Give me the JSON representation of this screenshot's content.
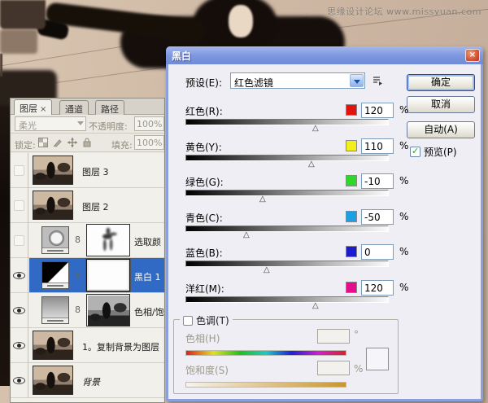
{
  "watermark": "思缘设计论坛 www.missyuan.com",
  "layers_panel": {
    "tabs": [
      {
        "label": "图层"
      },
      {
        "label": "通道"
      },
      {
        "label": "路径"
      }
    ],
    "tab_close": "×",
    "blend_mode": "柔光",
    "opacity_label": "不透明度:",
    "opacity_value": "100%",
    "lock_label": "锁定:",
    "fill_label": "填充:",
    "fill_value": "100%",
    "layers": [
      {
        "name": "图层 3",
        "visible": false,
        "selected": false,
        "thumb": "photo",
        "mask": null,
        "link": false,
        "italic": false
      },
      {
        "name": "图层 2",
        "visible": false,
        "selected": false,
        "thumb": "photo",
        "mask": null,
        "link": false,
        "italic": false
      },
      {
        "name": "选取颜",
        "visible": false,
        "selected": false,
        "thumb": "adjustment-circle",
        "mask": "figure",
        "link": true,
        "italic": false
      },
      {
        "name": "黑白 1",
        "visible": true,
        "selected": true,
        "thumb": "black-white",
        "mask": "white",
        "link": true,
        "italic": false
      },
      {
        "name": "色相/饱",
        "visible": true,
        "selected": false,
        "thumb": "gradient",
        "mask": "photo-gray",
        "link": true,
        "italic": false
      },
      {
        "name": "1。复制背景为图层",
        "visible": true,
        "selected": false,
        "thumb": "photo",
        "mask": null,
        "link": false,
        "italic": false
      },
      {
        "name": "背景",
        "visible": true,
        "selected": false,
        "thumb": "photo",
        "mask": null,
        "link": false,
        "italic": true
      }
    ]
  },
  "dialog": {
    "title": "黑白",
    "close_label": "×",
    "preset_label": "预设(E):",
    "preset_value": "红色滤镜",
    "ok_label": "确定",
    "cancel_label": "取消",
    "auto_label": "自动(A)",
    "preview_label": "预览(P)",
    "preview_checked": true,
    "percent": "%",
    "slider_range": {
      "min": -200,
      "max": 300
    },
    "sliders": [
      {
        "label": "红色(R):",
        "value": 120,
        "color": "#e2120e"
      },
      {
        "label": "黄色(Y):",
        "value": 110,
        "color": "#f2ee19"
      },
      {
        "label": "绿色(G):",
        "value": -10,
        "color": "#31d62c"
      },
      {
        "label": "青色(C):",
        "value": -50,
        "color": "#1ba0e4"
      },
      {
        "label": "蓝色(B):",
        "value": 0,
        "color": "#1b1bcd"
      },
      {
        "label": "洋红(M):",
        "value": 120,
        "color": "#e50c8e"
      }
    ],
    "tint": {
      "group_label": "色调(T)",
      "checked": false,
      "hue_label": "色相(H)",
      "hue_value": "",
      "hue_unit": "°",
      "sat_label": "饱和度(S)",
      "sat_value": "",
      "sat_unit": "%"
    }
  },
  "colors": {
    "selection_blue": "#316ac5",
    "titlebar_blue": "#7e98e0",
    "close_red": "#c8432a"
  }
}
